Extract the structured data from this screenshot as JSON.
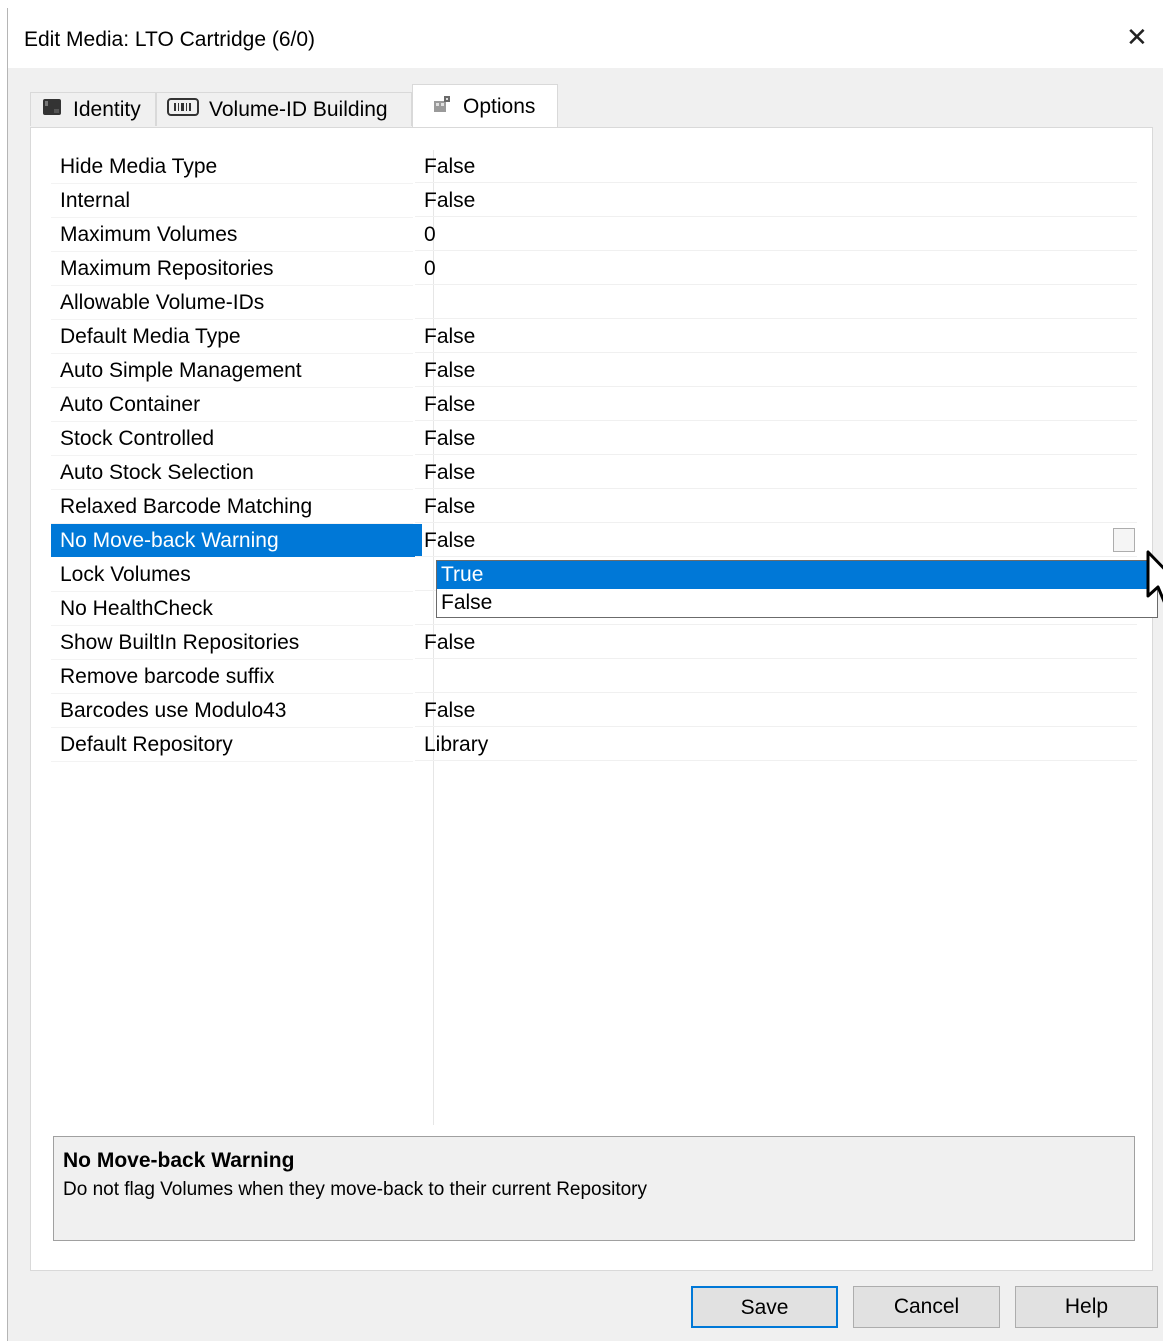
{
  "window": {
    "title": "Edit Media: LTO Cartridge (6/0)",
    "close_glyph": "✕"
  },
  "tabs": [
    {
      "label": "Identity",
      "icon": "cartridge-icon"
    },
    {
      "label": "Volume-ID Building",
      "icon": "barcode-icon"
    },
    {
      "label": "Options",
      "icon": "options-icon",
      "active": true
    }
  ],
  "properties": [
    {
      "name": "Hide Media Type",
      "value": "False"
    },
    {
      "name": "Internal",
      "value": "False"
    },
    {
      "name": "Maximum Volumes",
      "value": "0"
    },
    {
      "name": "Maximum Repositories",
      "value": "0"
    },
    {
      "name": "Allowable Volume-IDs",
      "value": ""
    },
    {
      "name": "Default Media Type",
      "value": "False"
    },
    {
      "name": "Auto Simple Management",
      "value": "False"
    },
    {
      "name": "Auto Container",
      "value": "False"
    },
    {
      "name": "Stock Controlled",
      "value": "False"
    },
    {
      "name": "Auto Stock Selection",
      "value": "False"
    },
    {
      "name": "Relaxed Barcode Matching",
      "value": "False"
    },
    {
      "name": "No Move-back Warning",
      "value": "False",
      "selected": true
    },
    {
      "name": "Lock Volumes",
      "value": ""
    },
    {
      "name": "No HealthCheck",
      "value": ""
    },
    {
      "name": "Show BuiltIn Repositories",
      "value": "False"
    },
    {
      "name": "Remove barcode suffix",
      "value": ""
    },
    {
      "name": "Barcodes use Modulo43",
      "value": "False"
    },
    {
      "name": "Default Repository",
      "value": "Library"
    }
  ],
  "dropdown": {
    "options": [
      "True",
      "False"
    ],
    "highlighted": "True"
  },
  "help": {
    "title": "No Move-back Warning",
    "description": "Do not flag Volumes when they move-back to their current Repository"
  },
  "buttons": {
    "save": "Save",
    "cancel": "Cancel",
    "help": "Help"
  },
  "colors": {
    "selection": "#0078d7",
    "dialog_bg": "#f0f0f0"
  }
}
